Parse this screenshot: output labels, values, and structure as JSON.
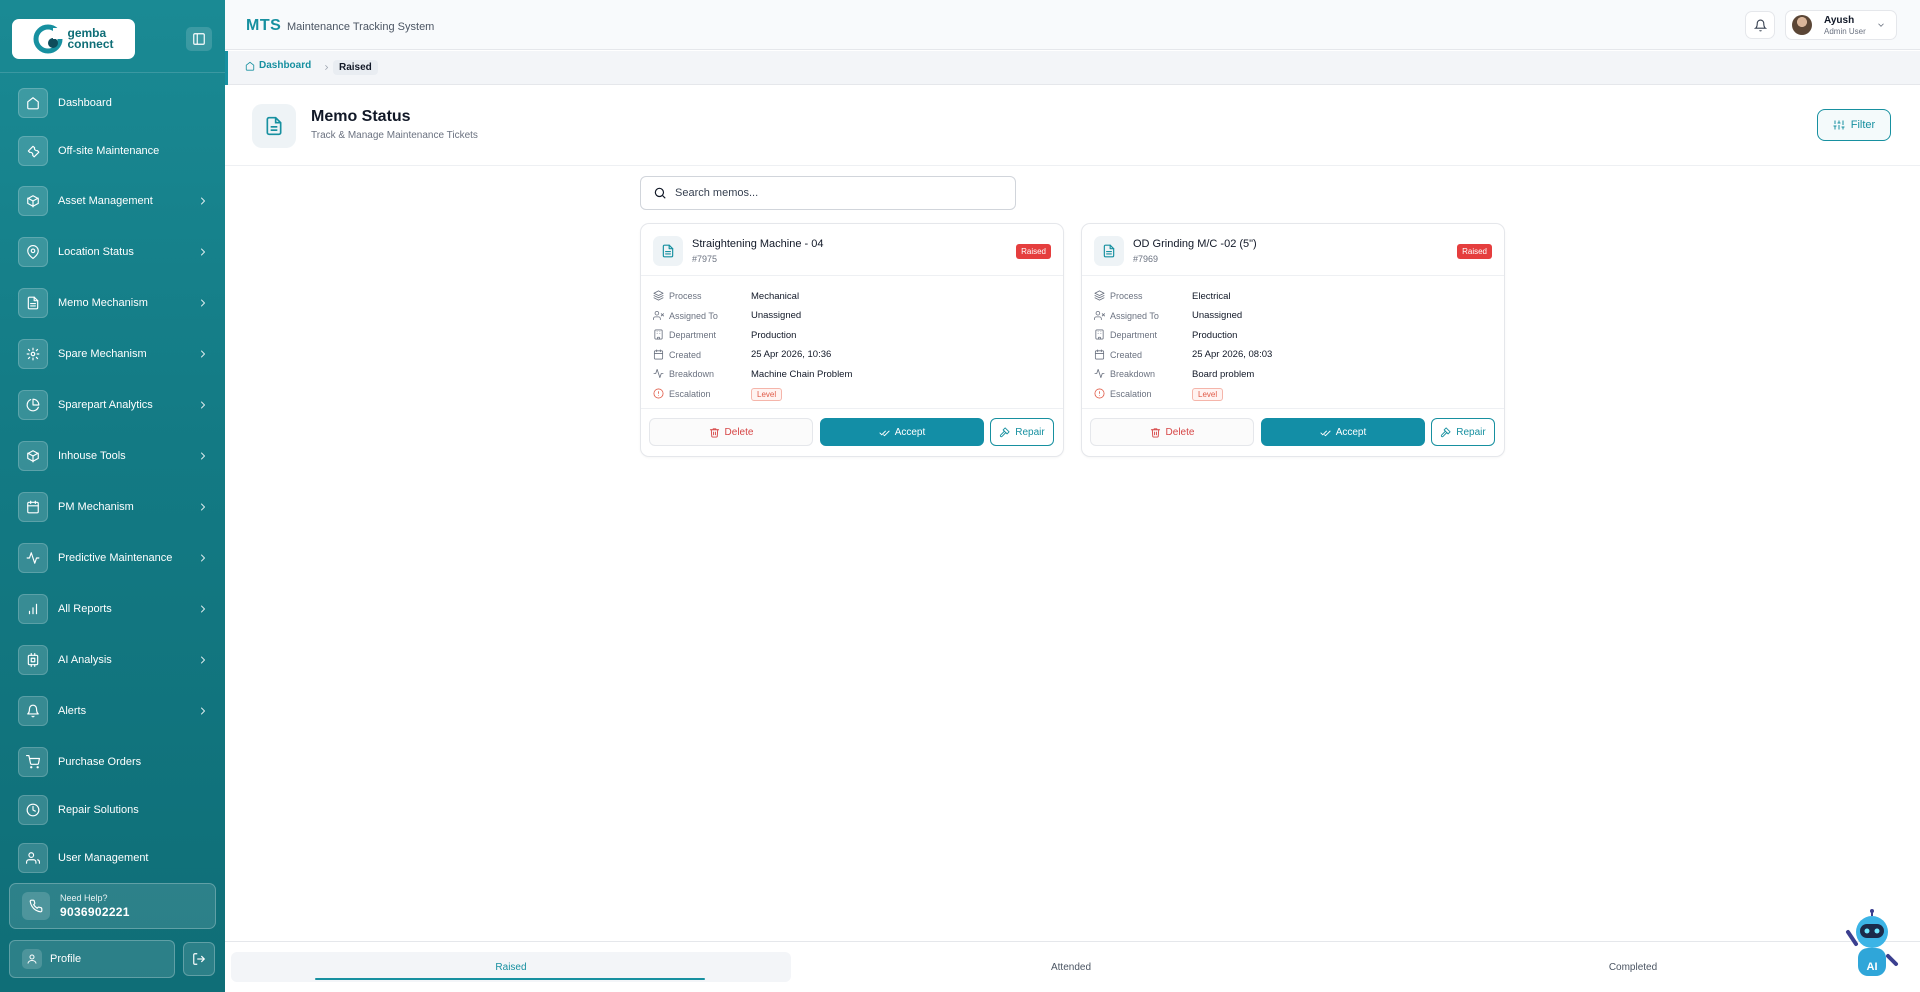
{
  "brand": {
    "logo_line1": "gemba",
    "logo_line2": "connect"
  },
  "sidebar": {
    "items": [
      {
        "label": "Dashboard",
        "icon": "home-icon",
        "chevron": false
      },
      {
        "label": "Off-site Maintenance",
        "icon": "wrench-icon",
        "chevron": false
      },
      {
        "label": "Asset Management",
        "icon": "box-icon",
        "chevron": true
      },
      {
        "label": "Location Status",
        "icon": "map-pin-icon",
        "chevron": true
      },
      {
        "label": "Memo Mechanism",
        "icon": "file-icon",
        "chevron": true
      },
      {
        "label": "Spare Mechanism",
        "icon": "settings-icon",
        "chevron": true
      },
      {
        "label": "Sparepart Analytics",
        "icon": "pie-chart-icon",
        "chevron": true
      },
      {
        "label": "Inhouse Tools",
        "icon": "cube-icon",
        "chevron": true
      },
      {
        "label": "PM Mechanism",
        "icon": "calendar-icon",
        "chevron": true
      },
      {
        "label": "Predictive Maintenance",
        "icon": "activity-icon",
        "chevron": true
      },
      {
        "label": "All Reports",
        "icon": "bar-chart-icon",
        "chevron": true
      },
      {
        "label": "AI Analysis",
        "icon": "cpu-icon",
        "chevron": true
      },
      {
        "label": "Alerts",
        "icon": "bell-icon",
        "chevron": true
      },
      {
        "label": "Purchase Orders",
        "icon": "cart-icon",
        "chevron": false
      },
      {
        "label": "Repair Solutions",
        "icon": "clock-icon",
        "chevron": false
      },
      {
        "label": "User Management",
        "icon": "users-icon",
        "chevron": false
      }
    ],
    "help": {
      "title": "Need Help?",
      "phone": "9036902221"
    },
    "profile_label": "Profile"
  },
  "header": {
    "app_abbr": "MTS",
    "app_name": "Maintenance Tracking System",
    "user": {
      "name": "Ayush",
      "role": "Admin User"
    }
  },
  "breadcrumb": {
    "home": "Dashboard",
    "current": "Raised"
  },
  "page": {
    "title": "Memo Status",
    "subtitle": "Track & Manage Maintenance Tickets",
    "filter_label": "Filter"
  },
  "search": {
    "placeholder": "Search memos..."
  },
  "field_labels": {
    "process": "Process",
    "assigned": "Assigned To",
    "department": "Department",
    "created": "Created",
    "breakdown": "Breakdown",
    "escalation": "Escalation"
  },
  "actions": {
    "delete": "Delete",
    "accept": "Accept",
    "repair": "Repair"
  },
  "memos": [
    {
      "title": "Straightening Machine - 04",
      "id": "#7975",
      "status": "Raised",
      "process": "Mechanical",
      "assigned": "Unassigned",
      "department": "Production",
      "created": "25 Apr 2026, 10:36",
      "breakdown": "Machine Chain Problem",
      "escalation": "Level"
    },
    {
      "title": "OD Grinding M/C -02 (5\")",
      "id": "#7969",
      "status": "Raised",
      "process": "Electrical",
      "assigned": "Unassigned",
      "department": "Production",
      "created": "25 Apr 2026, 08:03",
      "breakdown": "Board problem",
      "escalation": "Level"
    }
  ],
  "tabs": [
    {
      "label": "Raised",
      "active": true
    },
    {
      "label": "Attended",
      "active": false
    },
    {
      "label": "Completed",
      "active": false
    }
  ],
  "colors": {
    "primary": "#1790a0",
    "sidebar": "#137a84",
    "danger": "#e53e3e",
    "accept": "#138ea6"
  }
}
